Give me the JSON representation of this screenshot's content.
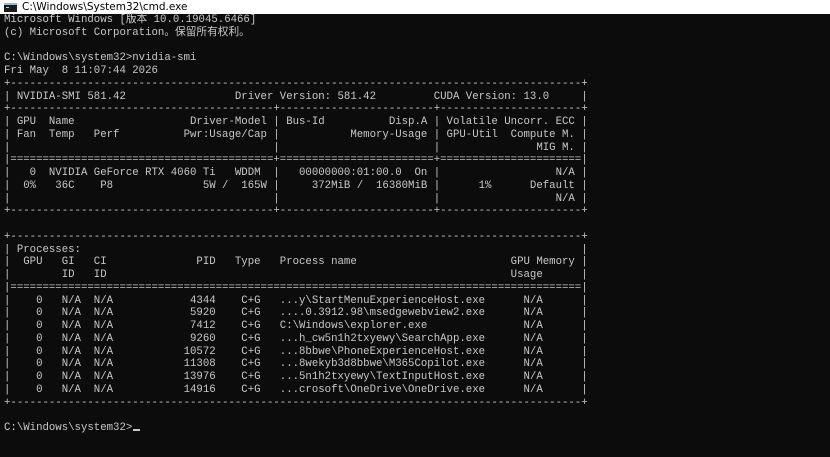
{
  "window": {
    "title": "C:\\Windows\\System32\\cmd.exe"
  },
  "console": {
    "lines": [
      "Microsoft Windows [版本 10.0.19045.6466]",
      "(c) Microsoft Corporation。保留所有权利。",
      "",
      "C:\\Windows\\system32>nvidia-smi",
      "Fri May  8 11:07:44 2026",
      "+-----------------------------------------------------------------------------------------+",
      "| NVIDIA-SMI 581.42                 Driver Version: 581.42         CUDA Version: 13.0     |",
      "+-----------------------------------------+------------------------+----------------------+",
      "| GPU  Name                  Driver-Model | Bus-Id          Disp.A | Volatile Uncorr. ECC |",
      "| Fan  Temp   Perf          Pwr:Usage/Cap |           Memory-Usage | GPU-Util  Compute M. |",
      "|                                         |                        |               MIG M. |",
      "|=========================================+========================+======================|",
      "|   0  NVIDIA GeForce RTX 4060 Ti   WDDM  |   00000000:01:00.0  On |                  N/A |",
      "|  0%   36C    P8              5W /  165W |     372MiB /  16380MiB |      1%      Default |",
      "|                                         |                        |                  N/A |",
      "+-----------------------------------------+------------------------+----------------------+",
      "",
      "+-----------------------------------------------------------------------------------------+",
      "| Processes:                                                                              |",
      "|  GPU   GI   CI              PID   Type   Process name                        GPU Memory |",
      "|        ID   ID                                                               Usage      |",
      "|=========================================================================================|",
      "|    0   N/A  N/A            4344    C+G   ...y\\StartMenuExperienceHost.exe      N/A      |",
      "|    0   N/A  N/A            5920    C+G   ....0.3912.98\\msedgewebview2.exe      N/A      |",
      "|    0   N/A  N/A            7412    C+G   C:\\Windows\\explorer.exe               N/A      |",
      "|    0   N/A  N/A            9260    C+G   ...h_cw5n1h2txyewy\\SearchApp.exe      N/A      |",
      "|    0   N/A  N/A           10572    C+G   ...8bbwe\\PhoneExperienceHost.exe      N/A      |",
      "|    0   N/A  N/A           11308    C+G   ...8wekyb3d8bbwe\\M365Copilot.exe      N/A      |",
      "|    0   N/A  N/A           13976    C+G   ...5n1h2txyewy\\TextInputHost.exe      N/A      |",
      "|    0   N/A  N/A           14916    C+G   ...crosoft\\OneDrive\\OneDrive.exe      N/A      |",
      "+-----------------------------------------------------------------------------------------+",
      ""
    ],
    "prompt": "C:\\Windows\\system32>",
    "input_value": ""
  }
}
